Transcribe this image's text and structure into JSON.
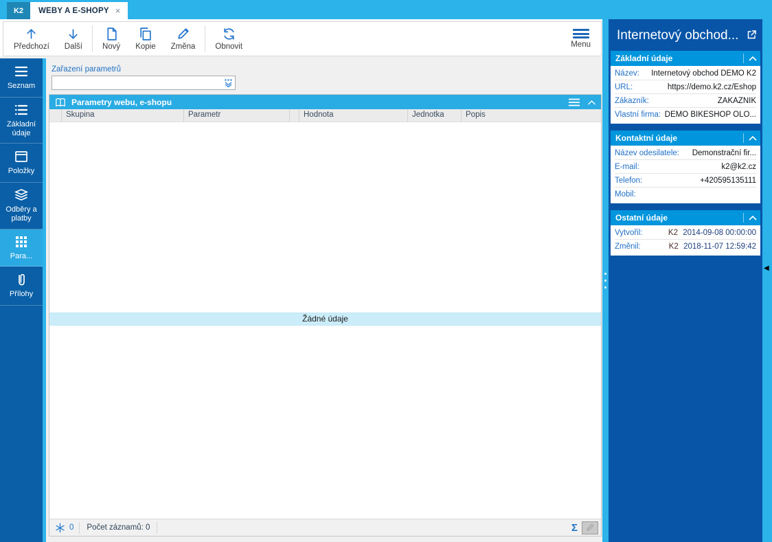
{
  "tabs": {
    "logo": "K2",
    "active": "WEBY A E-SHOPY",
    "close_glyph": "×"
  },
  "toolbar": {
    "prev": "Předchozí",
    "next": "Další",
    "new": "Nový",
    "copy": "Kopie",
    "change": "Změna",
    "refresh": "Obnovit",
    "menu": "Menu"
  },
  "sidebar": {
    "items": [
      {
        "label": "Seznam",
        "icon": "list-icon",
        "active": false
      },
      {
        "label": "Základní údaje",
        "icon": "detail-list-icon",
        "active": false
      },
      {
        "label": "Položky",
        "icon": "items-box-icon",
        "active": false
      },
      {
        "label": "Odběry a platby",
        "icon": "layers-icon",
        "active": false
      },
      {
        "label": "Para...",
        "icon": "grid-icon",
        "active": true
      },
      {
        "label": "Přílohy",
        "icon": "paperclip-icon",
        "active": false
      }
    ]
  },
  "filter": {
    "label": "Zařazení parametrů",
    "value": ""
  },
  "grid": {
    "title": "Parametry webu, e-shopu",
    "columns": [
      "",
      "Skupina",
      "Parametr",
      "",
      "Hodnota",
      "Jednotka",
      "Popis"
    ],
    "empty_text": "Žádné údaje",
    "status": {
      "selected_count": "0",
      "records_label": "Počet záznamů: 0",
      "sum_symbol": "Σ"
    }
  },
  "panel": {
    "title": "Internetový obchod...",
    "sections": [
      {
        "title": "Základní údaje",
        "rows": [
          {
            "label": "Název:",
            "value": "Internetový obchod DEMO K2"
          },
          {
            "label": "URL:",
            "value": "https://demo.k2.cz/Eshop"
          },
          {
            "label": "Zákazník:",
            "value": "ZÁKAZNÍK"
          },
          {
            "label": "Vlastní firma:",
            "value": "DEMO BIKESHOP OLO..."
          }
        ]
      },
      {
        "title": "Kontaktní údaje",
        "rows": [
          {
            "label": "Název odesilatele:",
            "value": "Demonstrační fir..."
          },
          {
            "label": "E-mail:",
            "value": "k2@k2.cz"
          },
          {
            "label": "Telefon:",
            "value": "+420595135111"
          },
          {
            "label": "Mobil:",
            "value": ""
          }
        ]
      },
      {
        "title": "Ostatní údaje",
        "rows": [
          {
            "label": "Vytvořil:",
            "user": "K2",
            "timestamp": "2014-09-08 00:00:00"
          },
          {
            "label": "Změnil:",
            "user": "K2",
            "timestamp": "2018-11-07 12:59:42"
          }
        ]
      }
    ]
  },
  "colors": {
    "accent_light_blue": "#2CB3EA",
    "sidebar_blue": "#0A5FA6",
    "panel_blue": "#0855A8",
    "section_header_blue": "#0095DC",
    "grid_header_blue": "#29ABE3",
    "active_item_blue": "#2BA9E2",
    "label_blue": "#1F6FC6",
    "empty_band_blue": "#CBEDF9"
  }
}
